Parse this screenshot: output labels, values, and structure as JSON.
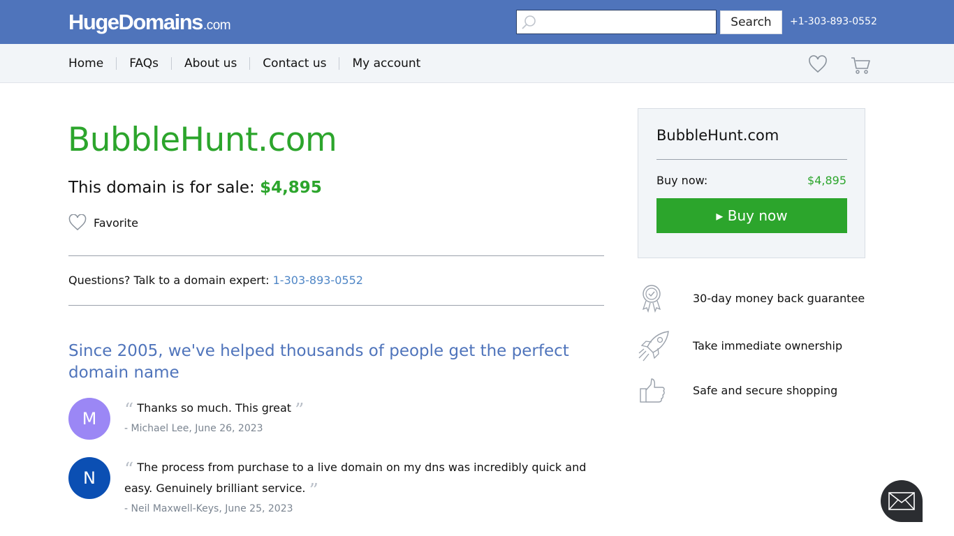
{
  "header": {
    "logo_main": "HugeDomains",
    "logo_tld": ".com",
    "search_placeholder": "",
    "search_button": "Search",
    "phone": "+1-303-893-0552"
  },
  "nav": {
    "items": [
      {
        "label": "Home"
      },
      {
        "label": "FAQs"
      },
      {
        "label": "About us"
      },
      {
        "label": "Contact us"
      },
      {
        "label": "My account"
      }
    ]
  },
  "main": {
    "domain": "BubbleHunt.com",
    "sale_text": "This domain is for sale:",
    "sale_price": "$4,895",
    "favorite_label": "Favorite",
    "questions_text": "Questions? Talk to a domain expert:",
    "questions_phone": "1-303-893-0552",
    "since_heading": "Since 2005, we've helped thousands of people get the perfect domain name",
    "reviews": [
      {
        "initial": "M",
        "text": "Thanks so much. This great",
        "author": "- Michael Lee, June 26, 2023",
        "avatar_color": "#9b87f5"
      },
      {
        "initial": "N",
        "text": "The process from purchase to a live domain on my dns was incredibly quick and easy. Genuinely brilliant service.",
        "author": "- Neil Maxwell-Keys, June 25, 2023",
        "avatar_color": "#0b4fb3"
      }
    ]
  },
  "panel": {
    "domain": "BubbleHunt.com",
    "buy_label": "Buy now:",
    "buy_price": "$4,895",
    "buy_button": "▸ Buy now"
  },
  "features": [
    {
      "icon": "award-ribbon-icon",
      "text": "30-day money back guarantee"
    },
    {
      "icon": "rocket-icon",
      "text": " Take immediate ownership"
    },
    {
      "icon": "thumbs-up-icon",
      "text": "Safe and secure shopping"
    }
  ],
  "colors": {
    "brand_blue": "#4f74bb",
    "accent_green": "#2ca52c",
    "link_blue": "#4f86c6"
  }
}
